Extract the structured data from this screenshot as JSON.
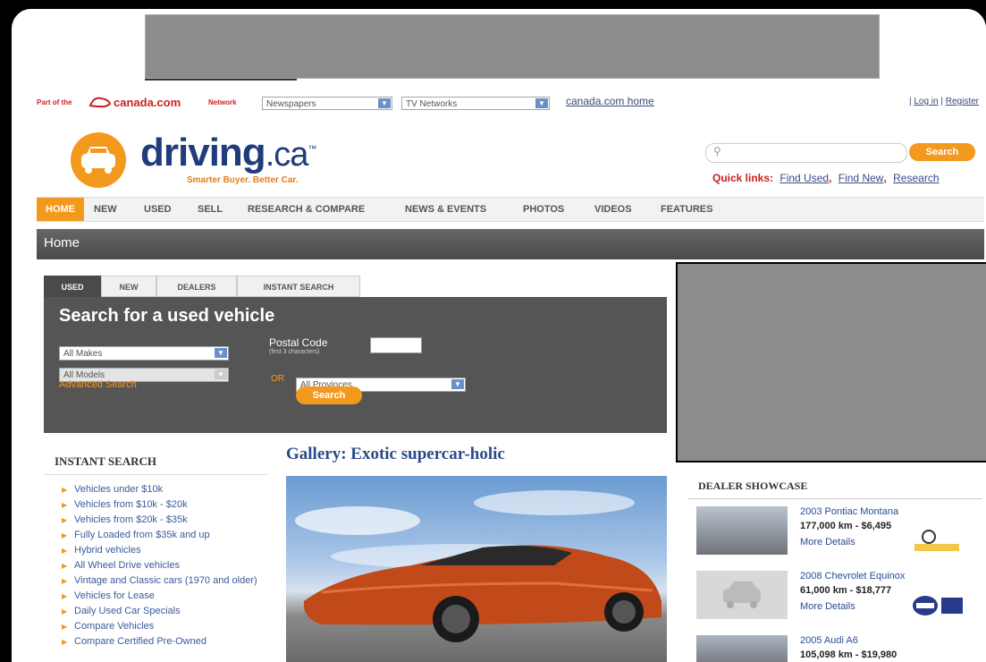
{
  "network_bar": {
    "part_of": "Part of the",
    "canada_brand": "canada.com",
    "network_label": "Network",
    "newspapers_select": "Newspapers",
    "tv_select": "TV Networks",
    "home_link": "canada.com home",
    "login": "Log in",
    "separator": "|",
    "register": "Register"
  },
  "header": {
    "brand": "driving",
    "brand_suffix": ".ca",
    "trademark": "™",
    "tagline": "Smarter Buyer. Better Car.",
    "search_button": "Search",
    "quick_links_label": "Quick links:",
    "quick_links": [
      "Find Used",
      "Find New",
      "Research"
    ]
  },
  "nav": {
    "items": [
      "HOME",
      "NEW",
      "USED",
      "SELL",
      "RESEARCH & COMPARE",
      "NEWS & EVENTS",
      "PHOTOS",
      "VIDEOS",
      "FEATURES"
    ],
    "active": "HOME"
  },
  "page_title": "Home",
  "search_panel": {
    "tabs": [
      "USED",
      "NEW",
      "DEALERS",
      "INSTANT SEARCH"
    ],
    "active_tab": "USED",
    "title": "Search for a used vehicle",
    "makes": "All Makes",
    "models": "All Models",
    "advanced": "Advanced Search",
    "postal_label": "Postal Code",
    "postal_sub": "(first 3 characters)",
    "or": "OR",
    "provinces": "All Provinces",
    "search_button": "Search"
  },
  "instant_search": {
    "title": "INSTANT SEARCH",
    "items": [
      "Vehicles under $10k",
      "Vehicles from $10k - $20k",
      "Vehicles from $20k - $35k",
      "Fully Loaded from $35k and up",
      "Hybrid vehicles",
      "All Wheel Drive vehicles",
      "Vintage and Classic cars (1970 and older)",
      "Vehicles for Lease",
      "Daily Used Car Specials",
      "Compare Vehicles",
      "Compare Certified Pre-Owned"
    ]
  },
  "gallery": {
    "title": "Gallery: Exotic supercar-holic"
  },
  "dealer_showcase": {
    "title": "DEALER SHOWCASE",
    "listings": [
      {
        "name": "2003 Pontiac Montana",
        "details": "177,000 km - $6,495",
        "more": "More Details"
      },
      {
        "name": "2008 Chevrolet Equinox",
        "details": "61,000 km - $18,777",
        "more": "More Details"
      },
      {
        "name": "2005 Audi A6",
        "details": "105,098 km - $19,980",
        "more": ""
      }
    ]
  },
  "colors": {
    "accent": "#f39a1e",
    "brand_blue": "#203c7c",
    "canada_red": "#d02020"
  }
}
